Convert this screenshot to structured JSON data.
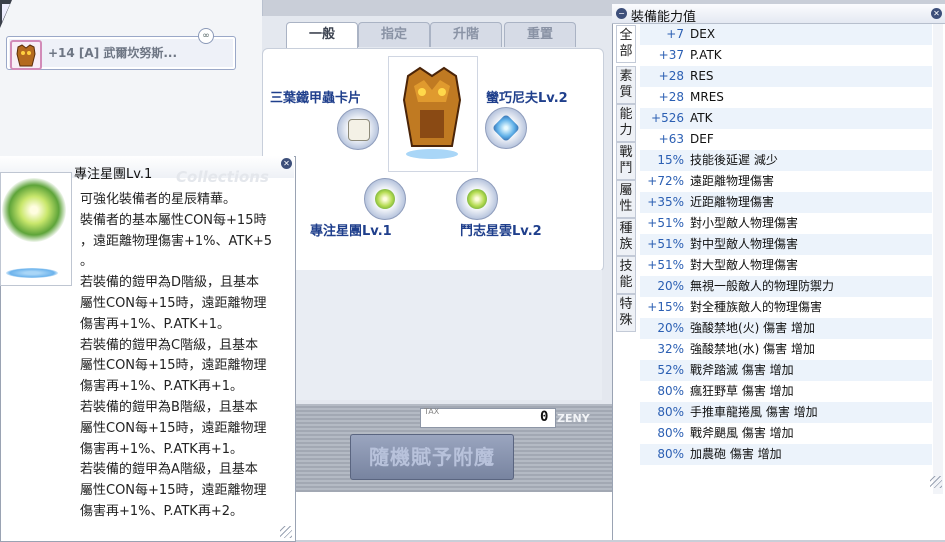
{
  "equip": {
    "name": "+14 [A] 武爾坎努斯..."
  },
  "refine": {
    "tabs": [
      {
        "label": "一般",
        "active": true
      },
      {
        "label": "指定",
        "active": false
      },
      {
        "label": "升階",
        "active": false
      },
      {
        "label": "重置",
        "active": false
      }
    ],
    "slots": [
      {
        "label": "三葉鐵甲蟲卡片",
        "icon": "card-icon"
      },
      {
        "label": "蠻巧尼夫Lv.2",
        "icon": "crystal-icon"
      },
      {
        "label": "專注星團Lv.1",
        "icon": "green-orb-icon"
      },
      {
        "label": "鬥志星雲Lv.2",
        "icon": "green-orb-icon"
      }
    ],
    "tax_label": "TAX",
    "tax_value": "0",
    "currency": "ZENY",
    "enchant_button": "隨機賦予附魔"
  },
  "tooltip": {
    "title": "專注星團Lv.1",
    "watermark": "Collections",
    "lines": [
      "可強化裝備者的星辰精華。",
      "裝備者的基本屬性CON每+15時",
      "，遠距離物理傷害+1%、ATK+5",
      "。",
      "若裝備的鎧甲為D階級，且基本",
      "屬性CON每+15時，遠距離物理",
      "傷害再+1%、P.ATK+1。",
      "若裝備的鎧甲為C階級，且基本",
      "屬性CON每+15時，遠距離物理",
      "傷害再+1%、P.ATK再+1。",
      "若裝備的鎧甲為B階級，且基本",
      "屬性CON每+15時，遠距離物理",
      "傷害再+1%、P.ATK再+1。",
      "若裝備的鎧甲為A階級，且基本",
      "屬性CON每+15時，遠距離物理",
      "傷害再+1%、P.ATK再+2。"
    ]
  },
  "stats": {
    "title": "裝備能力值",
    "tabs": [
      "全部",
      "素質",
      "能力",
      "戰鬥",
      "屬性",
      "種族",
      "技能",
      "特殊"
    ],
    "rows": [
      {
        "value": "+7",
        "name": "DEX"
      },
      {
        "value": "+37",
        "name": "P.ATK"
      },
      {
        "value": "+28",
        "name": "RES"
      },
      {
        "value": "+28",
        "name": "MRES"
      },
      {
        "value": "+526",
        "name": "ATK"
      },
      {
        "value": "+63",
        "name": "DEF"
      },
      {
        "value": "15%",
        "name": "技能後延遲 減少"
      },
      {
        "value": "+72%",
        "name": "遠距離物理傷害"
      },
      {
        "value": "+35%",
        "name": "近距離物理傷害"
      },
      {
        "value": "+51%",
        "name": "對小型敵人物理傷害"
      },
      {
        "value": "+51%",
        "name": "對中型敵人物理傷害"
      },
      {
        "value": "+51%",
        "name": "對大型敵人物理傷害"
      },
      {
        "value": "20%",
        "name": "無視一般敵人的物理防禦力"
      },
      {
        "value": "+15%",
        "name": "對全種族敵人的物理傷害"
      },
      {
        "value": "20%",
        "name": "強酸禁地(火) 傷害 增加"
      },
      {
        "value": "32%",
        "name": "強酸禁地(水) 傷害 增加"
      },
      {
        "value": "52%",
        "name": "戰斧踏滅 傷害 增加"
      },
      {
        "value": "80%",
        "name": "瘋狂野草 傷害 增加"
      },
      {
        "value": "80%",
        "name": "手推車龍捲風 傷害 增加"
      },
      {
        "value": "80%",
        "name": "戰斧颶風 傷害 增加"
      },
      {
        "value": "80%",
        "name": "加農砲 傷害 增加"
      }
    ]
  }
}
